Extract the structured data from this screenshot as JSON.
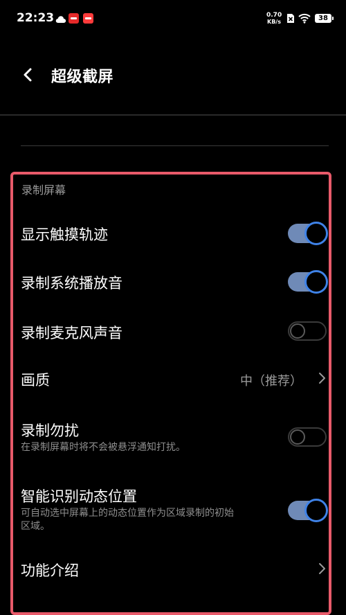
{
  "status_bar": {
    "time": "22:23",
    "net_speed_value": "0.70",
    "net_speed_unit": "KB/s",
    "battery_level": "38",
    "icons": [
      "cloud-icon",
      "app-badge-icon",
      "app-badge-icon",
      "sim-off-icon",
      "wifi-icon",
      "battery-icon"
    ]
  },
  "header": {
    "title": "超级截屏",
    "back_icon": "chevron-left-icon"
  },
  "section": {
    "title": "录制屏幕"
  },
  "settings": [
    {
      "title": "显示触摸轨迹",
      "control": "toggle",
      "state": "on"
    },
    {
      "title": "录制系统播放音",
      "control": "toggle",
      "state": "on"
    },
    {
      "title": "录制麦克风声音",
      "control": "toggle",
      "state": "off"
    },
    {
      "title": "画质",
      "control": "chevron",
      "value": "中（推荐）"
    },
    {
      "title": "录制勿扰",
      "description": "在录制屏幕时将不会被悬浮通知打扰。",
      "control": "toggle",
      "state": "off"
    },
    {
      "title": "智能识别动态位置",
      "description_line1": "可自动选中屏幕上的动态位置作为区域录制的初始",
      "description_line2": "区域。",
      "control": "toggle",
      "state": "on"
    },
    {
      "title": "功能介绍",
      "control": "chevron"
    }
  ],
  "colors": {
    "background": "#000000",
    "accent": "#3f82e7",
    "toggle_track_on": "#6f8ab7",
    "highlight_border": "#e85a6a",
    "secondary_text": "#9a9a9a"
  }
}
